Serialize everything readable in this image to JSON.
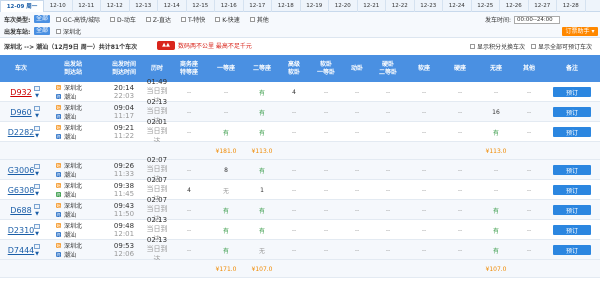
{
  "date_tabs": [
    "12-09 周一",
    "12-10",
    "12-11",
    "12-12",
    "12-13",
    "12-14",
    "12-15",
    "12-16",
    "12-17",
    "12-18",
    "12-19",
    "12-20",
    "12-21",
    "12-22",
    "12-23",
    "12-24",
    "12-25",
    "12-26",
    "12-27",
    "12-28"
  ],
  "filters": {
    "train_type_label": "车次类型:",
    "all_label": "全部",
    "train_types": [
      "GC-高铁/城际",
      "D-动车",
      "Z-直达",
      "T-特快",
      "K-快速",
      "其他"
    ],
    "depart_station_label": "出发车站:",
    "depart_stations": [
      "深圳北"
    ],
    "depart_time_label": "发车时间:",
    "depart_time_value": "00:00--24:00",
    "assistant_label": "订票助手"
  },
  "summary": {
    "route": "深圳北 --> 潮汕（12月9日 周一）共计81个车次",
    "promo": "数码两不公里 最高不足千元",
    "show_points": "显示积分兑换车次",
    "show_all": "显示全部可预订车次"
  },
  "columns": [
    "车次",
    "出发站\n到达站",
    "出发时间\n到达时间",
    "历时",
    "商务座\n特等座",
    "一等座",
    "二等座",
    "高级\n软卧",
    "软卧\n一等卧",
    "动卧",
    "硬卧\n二等卧",
    "软座",
    "硬座",
    "无座",
    "其他",
    "备注"
  ],
  "book_label": "预订",
  "trains": [
    {
      "no": "D932",
      "red": true,
      "from": "深圳北",
      "to": "潮汕",
      "dep": "20:14",
      "arr": "22:03",
      "dur": "01:49",
      "arr_day": "当日到达",
      "seats": [
        "--",
        "--",
        "有",
        "4",
        "--",
        "--",
        "--",
        "--",
        "--",
        "--",
        "--"
      ],
      "book": true
    },
    {
      "no": "D960",
      "red": false,
      "from": "深圳北",
      "to": "潮汕",
      "dep": "09:04",
      "arr": "11:17",
      "dur": "02:13",
      "arr_day": "当日到达",
      "seats": [
        "--",
        "--",
        "有",
        "--",
        "--",
        "--",
        "--",
        "--",
        "--",
        "16",
        "--"
      ],
      "book": true
    },
    {
      "no": "D2282",
      "red": false,
      "from": "深圳北",
      "to": "潮汕",
      "dep": "09:21",
      "arr": "11:22",
      "dur": "02:01",
      "arr_day": "当日到达",
      "seats": [
        "--",
        "有",
        "有",
        "--",
        "--",
        "--",
        "--",
        "--",
        "--",
        "有",
        "--"
      ],
      "book": true,
      "prices": {
        "first": "¥181.0",
        "second": "¥113.0",
        "none": "¥113.0"
      }
    },
    {
      "no": "G3006",
      "red": false,
      "from": "深圳北",
      "to": "潮汕",
      "dep": "09:26",
      "arr": "11:33",
      "dur": "02:07",
      "arr_day": "当日到达",
      "seats": [
        "--",
        "8",
        "有",
        "--",
        "--",
        "--",
        "--",
        "--",
        "--",
        "--",
        "--"
      ],
      "book": true
    },
    {
      "no": "G6308",
      "red": false,
      "from": "深圳北",
      "to": "潮汕",
      "dep": "09:38",
      "arr": "11:45",
      "dur": "02:07",
      "arr_day": "当日到达",
      "seats": [
        "4",
        "无",
        "1",
        "--",
        "--",
        "--",
        "--",
        "--",
        "--",
        "--",
        "--"
      ],
      "book": true
    },
    {
      "no": "D688",
      "red": false,
      "from": "深圳北",
      "to": "潮汕",
      "dep": "09:43",
      "arr": "11:50",
      "dur": "02:07",
      "arr_day": "当日到达",
      "seats": [
        "--",
        "有",
        "有",
        "--",
        "--",
        "--",
        "--",
        "--",
        "--",
        "有",
        "--"
      ],
      "book": true
    },
    {
      "no": "D2310",
      "red": false,
      "from": "深圳北",
      "to": "潮汕",
      "dep": "09:48",
      "arr": "12:01",
      "dur": "02:13",
      "arr_day": "当日到达",
      "seats": [
        "--",
        "有",
        "有",
        "--",
        "--",
        "--",
        "--",
        "--",
        "--",
        "有",
        "--"
      ],
      "book": true
    },
    {
      "no": "D7444",
      "red": false,
      "from": "深圳北",
      "to": "潮汕",
      "dep": "09:53",
      "arr": "12:06",
      "dur": "02:13",
      "arr_day": "当日到达",
      "seats": [
        "--",
        "有",
        "无",
        "--",
        "--",
        "--",
        "--",
        "--",
        "--",
        "有",
        "--"
      ],
      "book": true,
      "prices": {
        "first": "¥171.0",
        "second": "¥107.0",
        "none": "¥107.0"
      }
    }
  ]
}
